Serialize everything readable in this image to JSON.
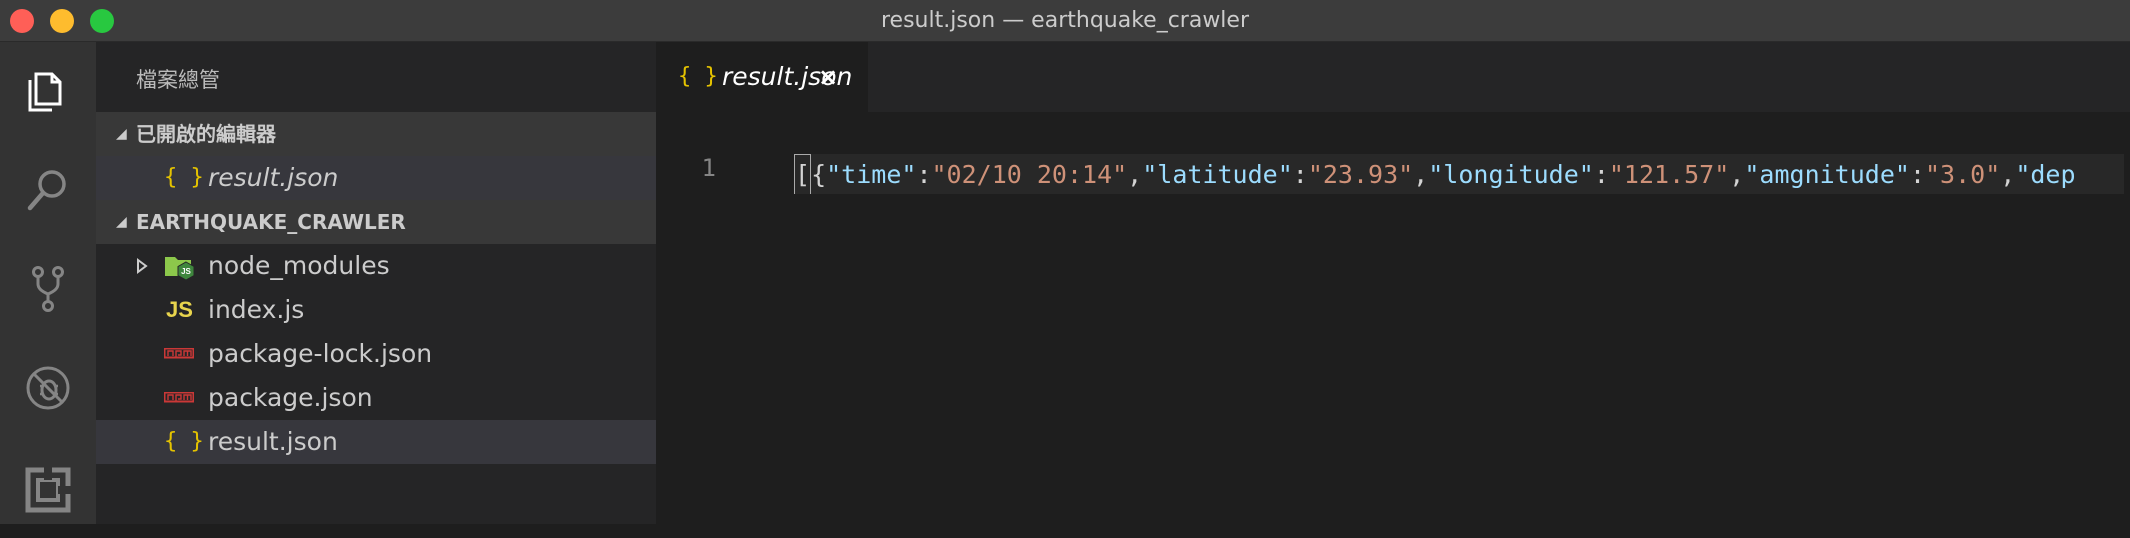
{
  "window": {
    "title": "result.json — earthquake_crawler"
  },
  "activity_bar": {
    "items": [
      {
        "name": "explorer-icon",
        "active": true
      },
      {
        "name": "search-icon",
        "active": false
      },
      {
        "name": "source-control-icon",
        "active": false
      },
      {
        "name": "debug-icon",
        "active": false
      },
      {
        "name": "extensions-icon",
        "active": false
      }
    ]
  },
  "sidebar": {
    "title": "檔案總管",
    "open_editors": {
      "label": "已開啟的編輯器",
      "items": [
        {
          "icon": "{ }",
          "label": "result.json"
        }
      ]
    },
    "project": {
      "label": "EARTHQUAKE_CRAWLER",
      "items": [
        {
          "icon": "node-folder-icon",
          "label": "node_modules",
          "type": "folder"
        },
        {
          "icon": "JS",
          "label": "index.js",
          "type": "file"
        },
        {
          "icon": "npm-icon",
          "label": "package-lock.json",
          "type": "file"
        },
        {
          "icon": "npm-icon",
          "label": "package.json",
          "type": "file"
        },
        {
          "icon": "{ }",
          "label": "result.json",
          "type": "file"
        }
      ]
    }
  },
  "editor": {
    "tab": {
      "icon": "{ }",
      "label": "result.json",
      "close": "×"
    },
    "line_number": "1",
    "code": {
      "open": "[{",
      "tokens": [
        {
          "k": "\"time\"",
          "v": "\"02/10 20:14\""
        },
        {
          "k": "\"latitude\"",
          "v": "\"23.93\""
        },
        {
          "k": "\"longitude\"",
          "v": "\"121.57\""
        },
        {
          "k": "\"amgnitude\"",
          "v": "\"3.0\""
        }
      ],
      "trailing": "\"dep"
    }
  },
  "colors": {
    "accent": "#e5c300",
    "key": "#9cdcfe",
    "string": "#ce9178"
  }
}
